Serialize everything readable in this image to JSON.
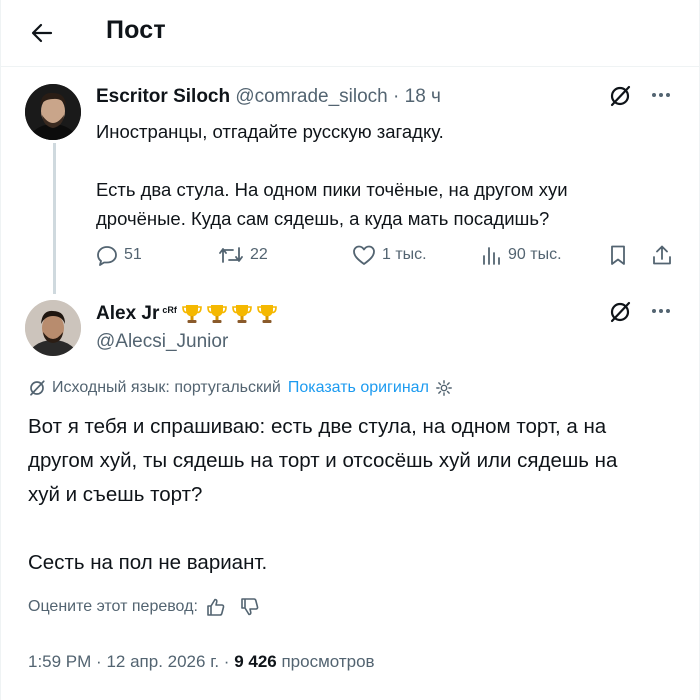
{
  "header": {
    "title": "Пост",
    "back_icon": "arrow-left-icon"
  },
  "post1": {
    "author_name": "Escritor Siloch",
    "handle": "@comrade_siloch",
    "separator": "·",
    "time": "18 ч",
    "lines": [
      "Иностранцы, отгадайте русскую загадку.",
      "",
      "Есть два стула. На одном пики точёные, на другом хуи",
      "дрочёные. Куда сам сядешь, а куда мать посадишь?"
    ],
    "metrics": {
      "replies": "51",
      "reposts": "22",
      "likes": "1 тыс.",
      "views": "90 тыс."
    }
  },
  "post2": {
    "author_name": "Alex Jr",
    "badge_text": "cRf",
    "trophy_count": 4,
    "handle": "@Alecsi_Junior",
    "translation_note": "Исходный язык: португальский",
    "show_original": "Показать оригинал",
    "lines": [
      "Вот я тебя и спрашиваю: есть две стула, на одном торт, а на",
      "другом хуй, ты сядешь на торт и отсосёшь хуй или сядешь на",
      "хуй и съешь торт?",
      "",
      "Сесть на пол не вариант."
    ],
    "rate_label": "Оцените этот перевод:",
    "time": "1:59 PM",
    "date": "12 апр. 2026 г.",
    "separator": "·",
    "views_count": "9 426",
    "views_label": "просмотров"
  },
  "colors": {
    "accent": "#1d9bf0",
    "muted": "#536471",
    "text": "#0f1419",
    "trophy": "#f5b800"
  }
}
